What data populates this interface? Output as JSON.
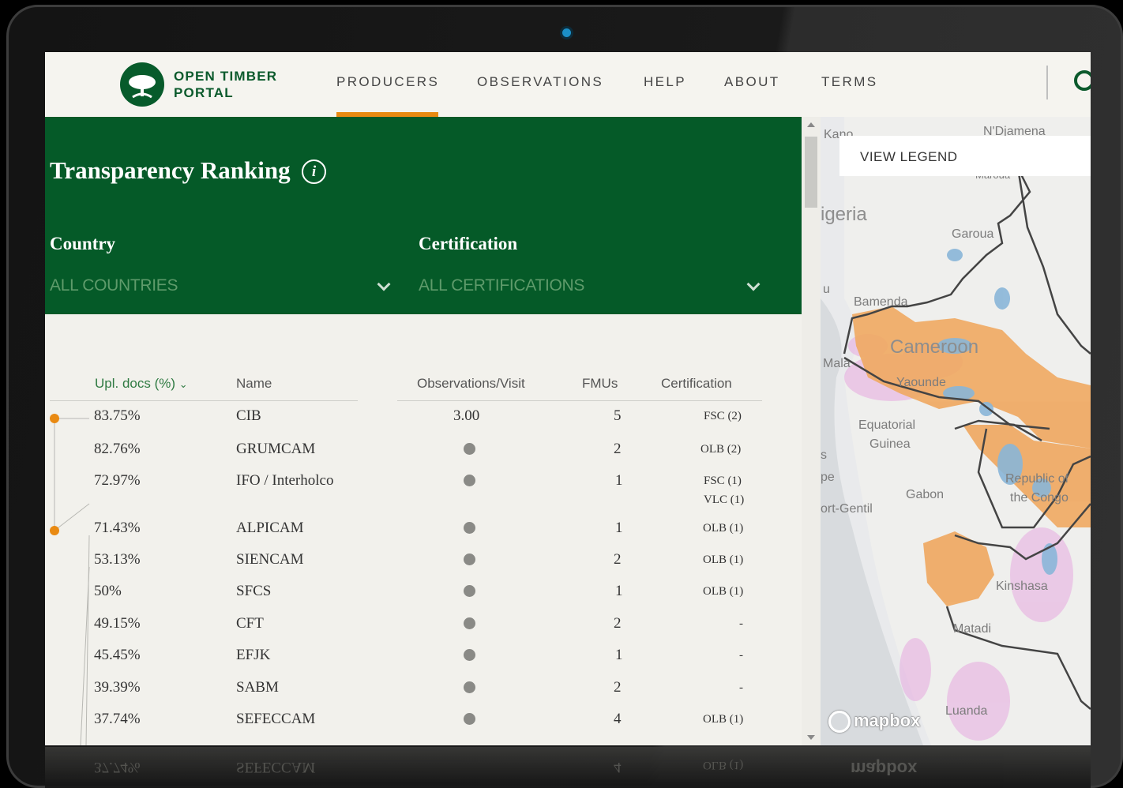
{
  "app": {
    "brand_line1": "OPEN TIMBER",
    "brand_line2": "PORTAL"
  },
  "nav": {
    "items": [
      "PRODUCERS",
      "OBSERVATIONS",
      "HELP",
      "ABOUT",
      "TERMS"
    ],
    "active": "PRODUCERS"
  },
  "filters": {
    "title": "Transparency Ranking",
    "info_glyph": "i",
    "country_label": "Country",
    "country_value": "ALL COUNTRIES",
    "certification_label": "Certification",
    "certification_value": "ALL CERTIFICATIONS"
  },
  "table": {
    "headers": {
      "upl": "Upl. docs (%)",
      "name": "Name",
      "obs": "Observations/Visit",
      "fmus": "FMUs",
      "cert": "Certification"
    },
    "rows": [
      {
        "upl": "83.75%",
        "name": "CIB",
        "obs": "3.00",
        "fmus": "5",
        "cert": [
          "FSC (2)"
        ]
      },
      {
        "upl": "82.76%",
        "name": "GRUMCAM",
        "obs": "",
        "fmus": "2",
        "cert": [
          "OLB (2)"
        ]
      },
      {
        "upl": "72.97%",
        "name": "IFO / Interholco",
        "obs": "",
        "fmus": "1",
        "cert": [
          "FSC (1)",
          "VLC (1)"
        ]
      },
      {
        "upl": "71.43%",
        "name": "ALPICAM",
        "obs": "",
        "fmus": "1",
        "cert": [
          "OLB (1)"
        ]
      },
      {
        "upl": "53.13%",
        "name": "SIENCAM",
        "obs": "",
        "fmus": "2",
        "cert": [
          "OLB (1)"
        ]
      },
      {
        "upl": "50%",
        "name": "SFCS",
        "obs": "",
        "fmus": "1",
        "cert": [
          "OLB (1)"
        ]
      },
      {
        "upl": "49.15%",
        "name": "CFT",
        "obs": "",
        "fmus": "2",
        "cert": [
          "-"
        ]
      },
      {
        "upl": "45.45%",
        "name": "EFJK",
        "obs": "",
        "fmus": "1",
        "cert": [
          "-"
        ]
      },
      {
        "upl": "39.39%",
        "name": "SABM",
        "obs": "",
        "fmus": "2",
        "cert": [
          "-"
        ]
      },
      {
        "upl": "37.74%",
        "name": "SEFECCAM",
        "obs": "",
        "fmus": "4",
        "cert": [
          "OLB (1)"
        ]
      }
    ]
  },
  "map": {
    "legend_button": "VIEW LEGEND",
    "attribution": "mapbox",
    "labels": {
      "kano": "Kano",
      "ndjamena": "N'Djamena",
      "maroua": "Maroua",
      "nigeria": "igeria",
      "garoua": "Garoua",
      "bamenda": "Bamenda",
      "cameroon": "Cameroon",
      "malabo": "Mala",
      "yaounde": "Yaounde",
      "eq1": "Equatorial",
      "eq2": "Guinea",
      "gabon": "Gabon",
      "rc1": "Republic of",
      "rc2": "the Congo",
      "portgentil": "ort-Gentil",
      "kinshasa": "Kinshasa",
      "matadi": "Matadi",
      "luanda": "Luanda",
      "u": "u",
      "s": "s",
      "pe": "pe"
    }
  },
  "reflection": {
    "upl": "37.74%",
    "name": "SEFECCAM",
    "fmus": "4",
    "cert": "OLB (1)",
    "mapbox": "mapbox"
  }
}
